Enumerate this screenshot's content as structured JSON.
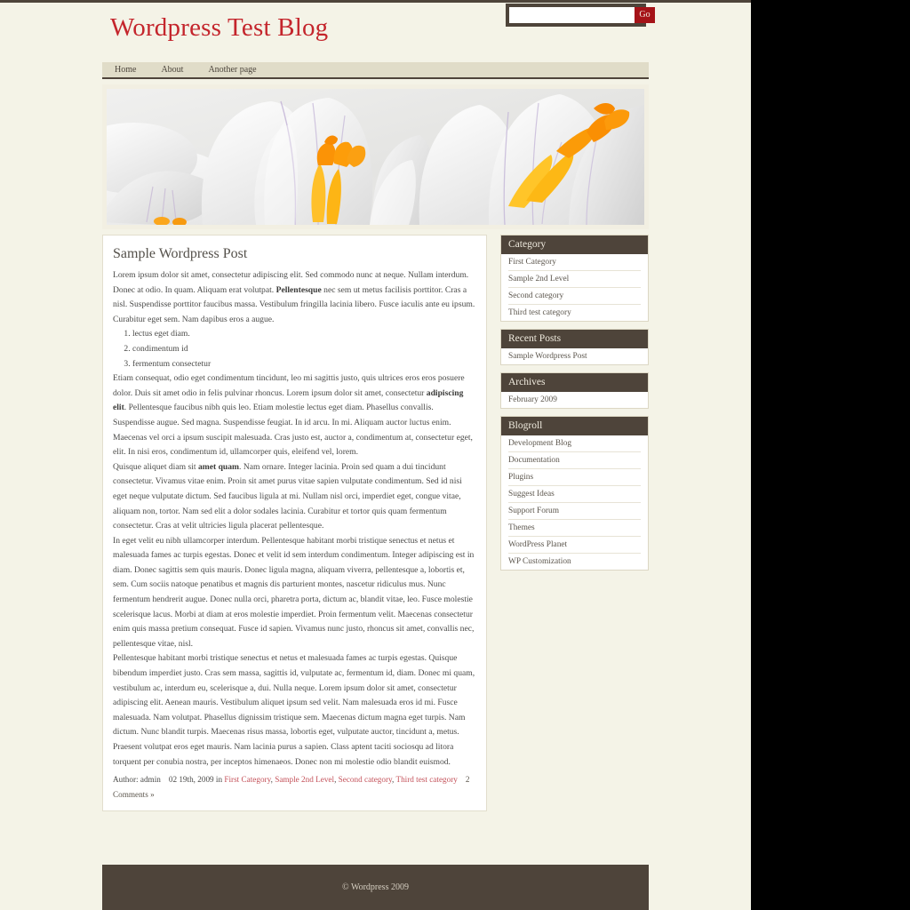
{
  "site": {
    "title": "Wordpress Test Blog",
    "accent_red": "#C4252C",
    "dark_brown": "#4E443A",
    "page_bg": "#F4F3E7"
  },
  "search": {
    "value": "",
    "placeholder": "",
    "button_label": "Go"
  },
  "nav": {
    "items": [
      {
        "label": "Home"
      },
      {
        "label": "About"
      },
      {
        "label": "Another page"
      }
    ]
  },
  "banner": {
    "alt": "Close-up photograph of white crocus flowers with orange stamens"
  },
  "post": {
    "title": "Sample Wordpress Post",
    "paragraph1_a": "Lorem ipsum dolor sit amet, consectetur adipiscing elit. Sed commodo nunc at neque. Nullam interdum. Donec at odio. In quam. Aliquam erat volutpat. ",
    "paragraph1_bold": "Pellentesque",
    "paragraph1_b": " nec sem ut metus facilisis porttitor. Cras a nisl. Suspendisse porttitor faucibus massa. Vestibulum fringilla lacinia libero. Fusce iaculis ante eu ipsum. Curabitur eget sem. Nam dapibus eros a augue.",
    "list": [
      "lectus eget diam.",
      "condimentum id",
      "fermentum consectetur"
    ],
    "paragraph2_a": "Etiam consequat, odio eget condimentum tincidunt, leo mi sagittis justo, quis ultrices eros eros posuere dolor. Duis sit amet odio in felis pulvinar rhoncus. Lorem ipsum dolor sit amet, consectetur ",
    "paragraph2_bold": "adipiscing elit",
    "paragraph2_b": ". Pellentesque faucibus nibh quis leo. Etiam molestie lectus eget diam. Phasellus convallis. Suspendisse augue. Sed magna. Suspendisse feugiat. In id arcu. In mi. Aliquam auctor luctus enim. Maecenas vel orci a ipsum suscipit malesuada. Cras justo est, auctor a, condimentum at, consectetur eget, elit. In nisi eros, condimentum id, ullamcorper quis, eleifend vel, lorem.",
    "paragraph3_a": "Quisque aliquet diam sit ",
    "paragraph3_bold": "amet quam",
    "paragraph3_b": ". Nam ornare. Integer lacinia. Proin sed quam a dui tincidunt consectetur. Vivamus vitae enim. Proin sit amet purus vitae sapien vulputate condimentum. Sed id nisi eget neque vulputate dictum. Sed faucibus ligula at mi. Nullam nisl orci, imperdiet eget, congue vitae, aliquam non, tortor. Nam sed elit a dolor sodales lacinia. Curabitur et tortor quis quam fermentum consectetur. Cras at velit ultricies ligula placerat pellentesque.",
    "paragraph4": "In eget velit eu nibh ullamcorper interdum. Pellentesque habitant morbi tristique senectus et netus et malesuada fames ac turpis egestas. Donec et velit id sem interdum condimentum. Integer adipiscing est in diam. Donec sagittis sem quis mauris. Donec ligula magna, aliquam viverra, pellentesque a, lobortis et, sem. Cum sociis natoque penatibus et magnis dis parturient montes, nascetur ridiculus mus. Nunc fermentum hendrerit augue. Donec nulla orci, pharetra porta, dictum ac, blandit vitae, leo. Fusce molestie scelerisque lacus. Morbi at diam at eros molestie imperdiet. Proin fermentum velit. Maecenas consectetur enim quis massa pretium consequat. Fusce id sapien. Vivamus nunc justo, rhoncus sit amet, convallis nec, pellentesque vitae, nisl.",
    "paragraph5": "Pellentesque habitant morbi tristique senectus et netus et malesuada fames ac turpis egestas. Quisque bibendum imperdiet justo. Cras sem massa, sagittis id, vulputate ac, fermentum id, diam. Donec mi quam, vestibulum ac, interdum eu, scelerisque a, dui. Nulla neque. Lorem ipsum dolor sit amet, consectetur adipiscing elit. Aenean mauris. Vestibulum aliquet ipsum sed velit. Nam malesuada eros id mi. Fusce malesuada. Nam volutpat. Phasellus dignissim tristique sem. Maecenas dictum magna eget turpis. Nam dictum. Nunc blandit turpis. Maecenas risus massa, lobortis eget, vulputate auctor, tincidunt a, metus. Praesent volutpat eros eget mauris. Nam lacinia purus a sapien. Class aptent taciti sociosqu ad litora torquent per conubia nostra, per inceptos himenaeos. Donec non mi molestie odio blandit euismod.",
    "meta": {
      "author": "Author: admin",
      "date": "02 19th, 2009 in",
      "categories": [
        {
          "label": "First Category"
        },
        {
          "label": "Sample 2nd Level"
        },
        {
          "label": "Second category"
        },
        {
          "label": "Third test category"
        }
      ],
      "comments": "2 Comments »"
    }
  },
  "sidebar": {
    "widgets": [
      {
        "title": "Category",
        "items": [
          {
            "label": "First Category"
          },
          {
            "label": "Sample 2nd Level"
          },
          {
            "label": "Second category"
          },
          {
            "label": "Third test category"
          }
        ]
      },
      {
        "title": "Recent Posts",
        "items": [
          {
            "label": "Sample Wordpress Post"
          }
        ]
      },
      {
        "title": "Archives",
        "items": [
          {
            "label": "February 2009"
          }
        ]
      },
      {
        "title": "Blogroll",
        "items": [
          {
            "label": "Development Blog"
          },
          {
            "label": "Documentation"
          },
          {
            "label": "Plugins"
          },
          {
            "label": "Suggest Ideas"
          },
          {
            "label": "Support Forum"
          },
          {
            "label": "Themes"
          },
          {
            "label": "WordPress Planet"
          },
          {
            "label": "WP Customization"
          }
        ]
      }
    ]
  },
  "footer": {
    "copyright": "© Wordpress 2009"
  }
}
